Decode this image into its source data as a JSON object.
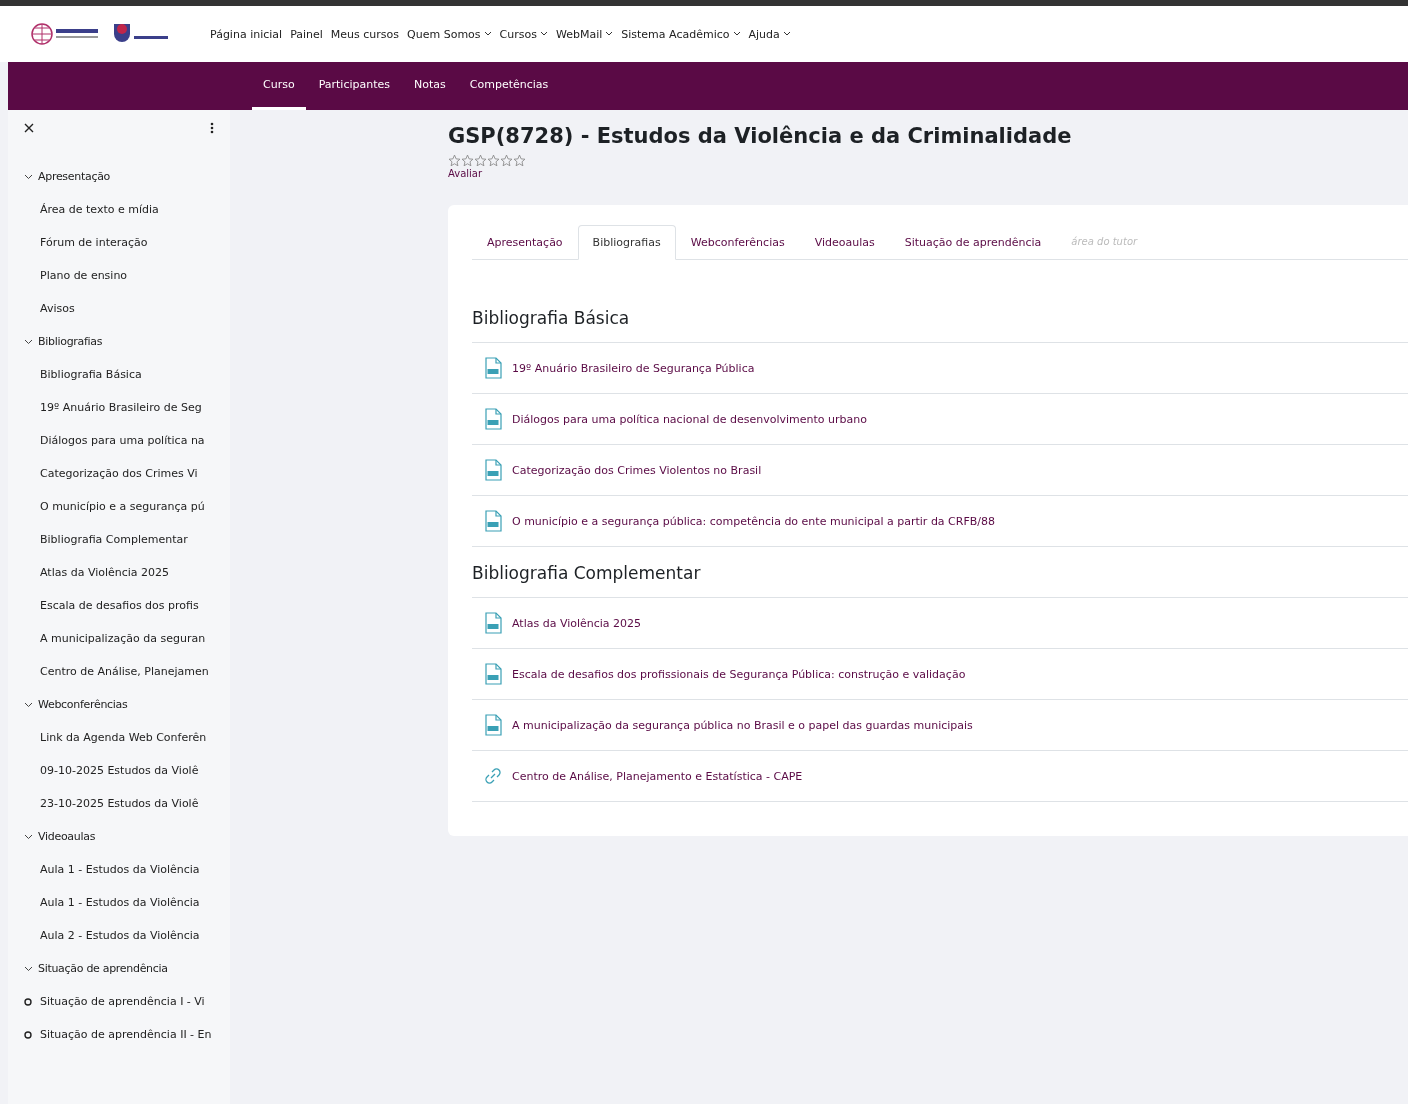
{
  "navbar": {
    "links": [
      {
        "label": "Página inicial",
        "dropdown": false
      },
      {
        "label": "Painel",
        "dropdown": false
      },
      {
        "label": "Meus cursos",
        "dropdown": false
      },
      {
        "label": "Quem Somos",
        "dropdown": true
      },
      {
        "label": "Cursos",
        "dropdown": true
      },
      {
        "label": "WebMail",
        "dropdown": true
      },
      {
        "label": "Sistema Acadêmico",
        "dropdown": true
      },
      {
        "label": "Ajuda",
        "dropdown": true
      }
    ]
  },
  "course_nav": [
    {
      "label": "Curso",
      "selected": true
    },
    {
      "label": "Participantes",
      "selected": false
    },
    {
      "label": "Notas",
      "selected": false
    },
    {
      "label": "Competências",
      "selected": false
    }
  ],
  "sidebar": {
    "sections": [
      {
        "title": "Apresentação",
        "expanded": true,
        "items": [
          {
            "label": "Área de texto e mídia",
            "kind": "page"
          },
          {
            "label": "Fórum de interação",
            "kind": "page"
          },
          {
            "label": "Plano de ensino",
            "kind": "page"
          },
          {
            "label": "Avisos",
            "kind": "page"
          }
        ]
      },
      {
        "title": "Bibliografias",
        "expanded": true,
        "items": [
          {
            "label": "Bibliografia Básica",
            "kind": "page"
          },
          {
            "label": "19º Anuário Brasileiro de Seg",
            "kind": "page"
          },
          {
            "label": "Diálogos para uma política na",
            "kind": "page"
          },
          {
            "label": "Categorização dos Crimes Vi",
            "kind": "page"
          },
          {
            "label": "O município e a segurança pú",
            "kind": "page"
          },
          {
            "label": "Bibliografia Complementar",
            "kind": "page"
          },
          {
            "label": "Atlas da Violência 2025",
            "kind": "page"
          },
          {
            "label": "Escala de desafios dos profis",
            "kind": "page"
          },
          {
            "label": "A municipalização da seguran",
            "kind": "page"
          },
          {
            "label": "Centro de Análise, Planejamen",
            "kind": "page"
          }
        ]
      },
      {
        "title": "Webconferências",
        "expanded": true,
        "items": [
          {
            "label": "Link da Agenda Web Conferên",
            "kind": "page"
          },
          {
            "label": "09-10-2025 Estudos da Violê",
            "kind": "page"
          },
          {
            "label": "23-10-2025 Estudos da Violê",
            "kind": "page"
          }
        ]
      },
      {
        "title": "Videoaulas",
        "expanded": true,
        "items": [
          {
            "label": "Aula 1 - Estudos da Violência",
            "kind": "page"
          },
          {
            "label": "Aula 1 - Estudos da Violência",
            "kind": "page"
          },
          {
            "label": "Aula 2 - Estudos da Violência",
            "kind": "page"
          }
        ]
      },
      {
        "title": "Situação de aprendência",
        "expanded": true,
        "items": [
          {
            "label": "Situação de aprendência I - Vi",
            "kind": "activity"
          },
          {
            "label": "Situação de aprendência II - En",
            "kind": "activity"
          }
        ]
      }
    ]
  },
  "course": {
    "title": "GSP(8728) - Estudos da Violência e da Criminalidade",
    "stars": 0,
    "rate_link": "Avaliar"
  },
  "tabs": [
    {
      "label": "Apresentação",
      "selected": false,
      "disabled": false
    },
    {
      "label": "Bibliografias",
      "selected": true,
      "disabled": false
    },
    {
      "label": "Webconferências",
      "selected": false,
      "disabled": false
    },
    {
      "label": "Videoaulas",
      "selected": false,
      "disabled": false
    },
    {
      "label": "Situação de aprendência",
      "selected": false,
      "disabled": false
    },
    {
      "label": "área do tutor",
      "selected": false,
      "disabled": true
    }
  ],
  "sections": [
    {
      "heading": "Bibliografia Básica",
      "items": [
        {
          "label": "19º Anuário Brasileiro de Segurança Pública",
          "kind": "pdf"
        },
        {
          "label": "Diálogos para uma política nacional de desenvolvimento urbano",
          "kind": "pdf"
        },
        {
          "label": "Categorização dos Crimes Violentos no Brasil",
          "kind": "pdf"
        },
        {
          "label": "O município e a segurança pública: competência do ente municipal a partir da CRFB/88",
          "kind": "pdf"
        }
      ]
    },
    {
      "heading": "Bibliografia Complementar",
      "items": [
        {
          "label": "Atlas da Violência 2025",
          "kind": "pdf"
        },
        {
          "label": "Escala de desafios dos profissionais de Segurança Pública: construção e validação",
          "kind": "pdf"
        },
        {
          "label": "A municipalização da segurança pública no Brasil e o papel das guardas municipais",
          "kind": "pdf"
        },
        {
          "label": "Centro de Análise, Planejamento e Estatística - CAPE",
          "kind": "url"
        }
      ]
    }
  ]
}
